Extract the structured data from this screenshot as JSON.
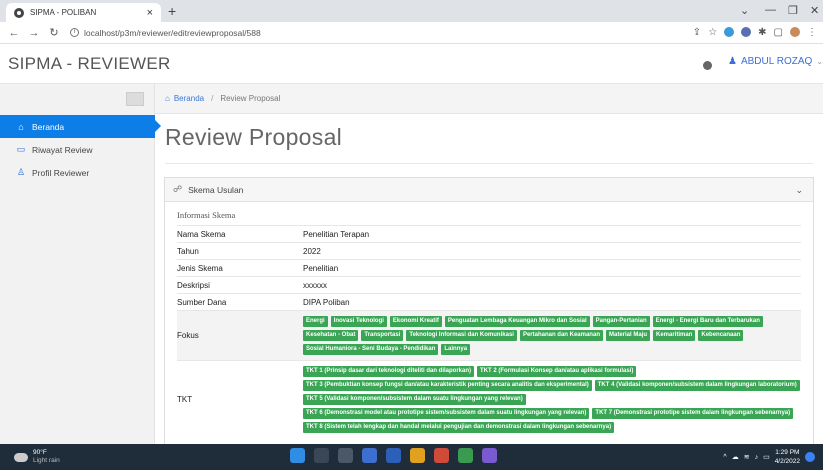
{
  "browser": {
    "tab_title": "SIPMA - POLIBAN",
    "url": "localhost/p3m/reviewer/editreviewproposal/588",
    "new_tab": "+",
    "minimize": "—",
    "maximize": "❐",
    "close": "✕"
  },
  "app": {
    "brand": "SIPMA - REVIEWER",
    "user_name": "ABDUL ROZAQ"
  },
  "sidebar": {
    "items": [
      {
        "label": "Beranda",
        "icon": "home-icon",
        "active": true
      },
      {
        "label": "Riwayat Review",
        "icon": "folder-icon",
        "active": false
      },
      {
        "label": "Profil Reviewer",
        "icon": "user-icon",
        "active": false
      }
    ]
  },
  "breadcrumb": {
    "home": "Beranda",
    "current": "Review Proposal"
  },
  "page": {
    "title": "Review Proposal"
  },
  "card": {
    "title": "Skema Usulan",
    "section": "Informasi Skema",
    "rows": {
      "nama_skema": {
        "label": "Nama Skema",
        "value": "Penelitian Terapan"
      },
      "tahun": {
        "label": "Tahun",
        "value": "2022"
      },
      "jenis_skema": {
        "label": "Jenis Skema",
        "value": "Penelitian"
      },
      "deskripsi": {
        "label": "Deskripsi",
        "value": "xxxxxx"
      },
      "sumber_dana": {
        "label": "Sumber Dana",
        "value": "DIPA Poliban"
      },
      "fokus_label": "Fokus",
      "tkt_label": "TKT"
    },
    "fokus": [
      "Energi",
      "Inovasi Teknologi",
      "Ekonomi Kreatif",
      "Penguatan Lembaga Keuangan Mikro dan Sosial",
      "Pangan-Pertanian",
      "Energi - Energi Baru dan Terbarukan",
      "Kesehatan - Obat",
      "Transportasi",
      "Teknologi Informasi dan Komunikasi",
      "Pertahanan dan Keamanan",
      "Material Maju",
      "Kemaritiman",
      "Kebencanaan",
      "Sosial Humaniora - Seni Budaya - Pendidikan",
      "Lainnya"
    ],
    "tkt": [
      "TKT 1 (Prinsip dasar dari teknologi diteliti dan dilaporkan)",
      "TKT 2 (Formulasi Konsep dan/atau aplikasi formulasi)",
      "TKT 3 (Pembuktian konsep fungsi dan/atau karakteristik penting secara analitis dan eksperimental)",
      "TKT 4 (Validasi komponen/subsistem dalam lingkungan laboratorium)",
      "TKT 5 (Validasi komponen/subsistem dalam suatu lingkungan yang relevan)",
      "TKT 6 (Demonstrasi model atau prototipe sistem/subsistem dalam suatu lingkungan yang relevan)",
      "TKT 7 (Demonstrasi prototipe sistem dalam lingkungan sebenarnya)",
      "TKT 8 (Sistem telah lengkap dan handal melalui pengujian dan demonstrasi dalam lingkungan sebenarnya)"
    ]
  },
  "taskbar": {
    "temp": "90°F",
    "weather": "Light rain",
    "time": "1:29 PM",
    "date": "4/2/2022"
  },
  "colors": {
    "accent": "#0d7de8",
    "badge": "#3aa655",
    "taskbar": "#1f2d3b"
  }
}
